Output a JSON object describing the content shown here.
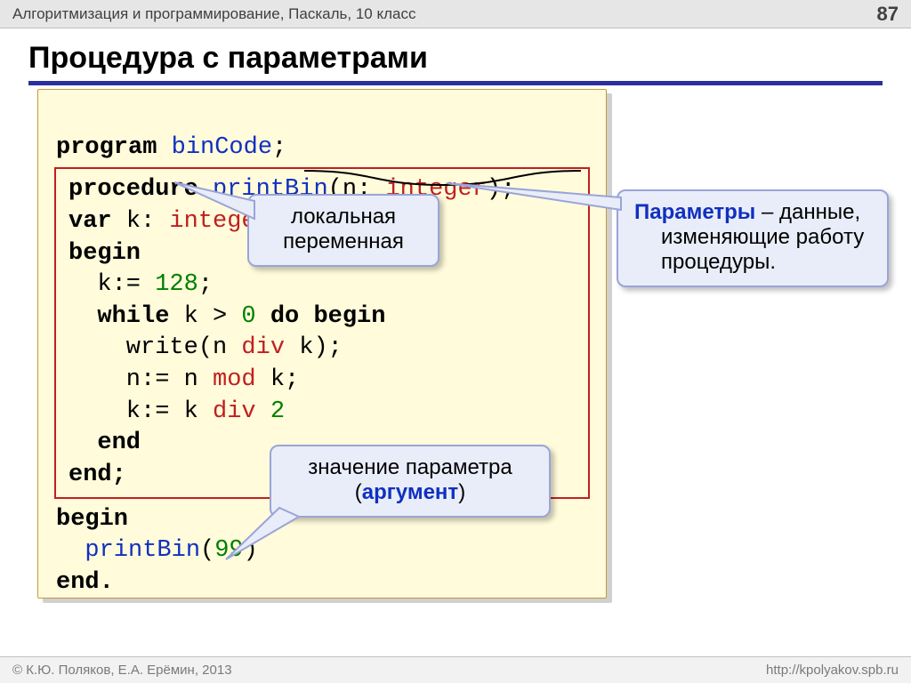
{
  "header": {
    "subject": "Алгоритмизация и программирование, Паскаль, 10 класс",
    "page": "87"
  },
  "title": "Процедура с параметрами",
  "code": {
    "l1_program": "program",
    "l1_name": "binCode",
    "l1_semi": ";",
    "l2_proc": "procedure",
    "l2_name": "printBin",
    "l2_open": "(",
    "l2_param": "n",
    "l2_colon": ":",
    "l2_space": " ",
    "l2_type": "integer",
    "l2_close": ")",
    "l2_semi": ";",
    "l3_var": "var",
    "l3_k": "k",
    "l3_colon": ":",
    "l3_space": " ",
    "l3_type": "integer",
    "l3_semi": ";",
    "l4": "begin",
    "l5_lhs": "  k:=",
    "l5_val": "128",
    "l5_semi": ";",
    "l6_a": "  while",
    "l6_b": " k",
    "l6_c": " >",
    "l6_d": " 0",
    "l6_e": " do begin",
    "l7_a": "    write(n",
    "l7_b": " div",
    "l7_c": " k);",
    "l8_a": "    n:=",
    "l8_b": " n",
    "l8_c": " mod",
    "l8_d": " k;",
    "l9_a": "    k:=",
    "l9_b": " k",
    "l9_c": " div",
    "l9_d": " 2",
    "l10": "  end",
    "l11": "end;",
    "l12": "begin",
    "l13_a": "  printBin",
    "l13_b": "(",
    "l13_c": "99",
    "l13_d": ")",
    "l14": "end."
  },
  "callouts": {
    "local_var": {
      "line1": "локальная",
      "line2": "переменная"
    },
    "params": {
      "p_word": "Параметры",
      "rest1": " – данные,",
      "rest2": "изменяющие работу",
      "rest3": "процедуры."
    },
    "argument": {
      "line1": "значение параметра",
      "line2_open": "(",
      "line2_word": "аргумент",
      "line2_close": ")"
    }
  },
  "footer": {
    "copyright": "© К.Ю. Поляков, Е.А. Ерёмин, 2013",
    "url": "http://kpolyakov.spb.ru"
  }
}
